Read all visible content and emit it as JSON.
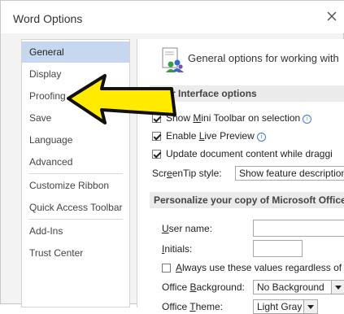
{
  "window": {
    "title": "Word Options"
  },
  "sidebar": {
    "items": [
      {
        "label": "General",
        "active": true
      },
      {
        "label": "Display"
      },
      {
        "label": "Proofing"
      },
      {
        "label": "Save"
      },
      {
        "label": "Language"
      },
      {
        "label": "Advanced"
      },
      {
        "label": "Customize Ribbon"
      },
      {
        "label": "Quick Access Toolbar"
      },
      {
        "label": "Add-Ins"
      },
      {
        "label": "Trust Center"
      }
    ]
  },
  "main": {
    "header": "General options for working with",
    "ui_section": "User Interface options",
    "options": {
      "mini_toolbar": {
        "prefix": "Show ",
        "underline": "M",
        "rest": "ini Toolbar on selection",
        "checked": true
      },
      "live_preview": {
        "prefix": "Enable ",
        "underline": "L",
        "rest": "ive Preview",
        "checked": true
      },
      "update_content": {
        "label": "Update document content while draggi",
        "checked": true
      }
    },
    "screentip": {
      "pre": "Scr",
      "underline": "e",
      "post": "enTip style:",
      "value": "Show feature description"
    },
    "personalize_section": "Personalize your copy of Microsoft Office",
    "user_name": {
      "underline": "U",
      "rest": "ser name:"
    },
    "initials": {
      "underline": "I",
      "rest": "nitials:"
    },
    "always_use": {
      "underline": "A",
      "rest": "lways use these values regardless of si",
      "checked": false
    },
    "office_background": {
      "pre": "Office ",
      "underline": "B",
      "post": "ackground:",
      "value": "No Background"
    },
    "office_theme": {
      "pre": "Office ",
      "underline": "T",
      "post": "heme:",
      "value": "Light Gray"
    }
  },
  "colors": {
    "accent_arrow": "#ffea00",
    "active_nav": "#c5d8f0"
  },
  "icons": [
    "close-icon",
    "general-options-icon",
    "info-icon",
    "pointer-arrow"
  ]
}
